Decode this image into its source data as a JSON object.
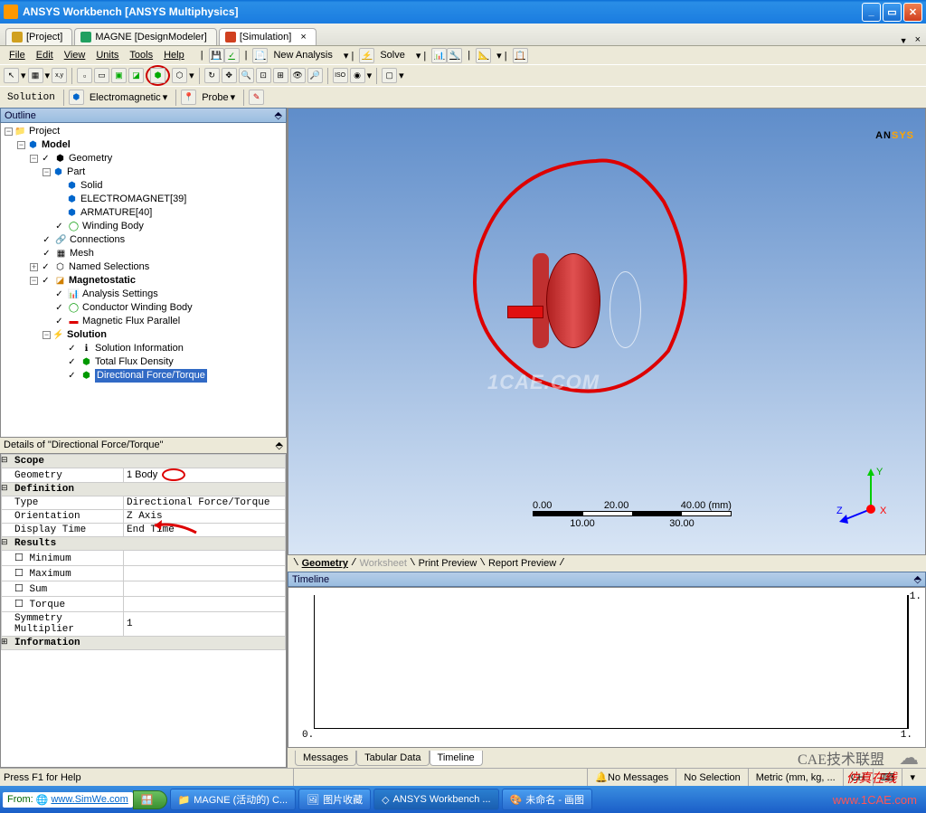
{
  "title": "ANSYS Workbench [ANSYS Multiphysics]",
  "doctabs": [
    {
      "label": "[Project]",
      "color": "#d0a020"
    },
    {
      "label": "MAGNE [DesignModeler]",
      "color": "#20a060"
    },
    {
      "label": "[Simulation]",
      "color": "#d04020",
      "active": true
    }
  ],
  "menu": {
    "items": [
      "File",
      "Edit",
      "View",
      "Units",
      "Tools",
      "Help"
    ],
    "after": [
      "New Analysis",
      "Solve"
    ]
  },
  "toolbar3": {
    "solution": "Solution",
    "electro": "Electromagnetic",
    "probe": "Probe"
  },
  "outline_hdr": "Outline",
  "tree": {
    "project": "Project",
    "model": "Model",
    "geometry": "Geometry",
    "part": "Part",
    "solid": "Solid",
    "electromagnet": "ELECTROMAGNET[39]",
    "armature": "ARMATURE[40]",
    "windingbody": "Winding Body",
    "connections": "Connections",
    "mesh": "Mesh",
    "namedsel": "Named Selections",
    "magneto": "Magnetostatic",
    "analysis": "Analysis Settings",
    "conductor": "Conductor Winding Body",
    "magflux": "Magnetic Flux Parallel",
    "solution": "Solution",
    "solinfo": "Solution Information",
    "totalflux": "Total Flux Density",
    "dirforce": "Directional Force/Torque"
  },
  "details_hdr": "Details of \"Directional Force/Torque\"",
  "details": {
    "scope": "Scope",
    "geometry_k": "Geometry",
    "geometry_v": "1 Body",
    "definition": "Definition",
    "type_k": "Type",
    "type_v": "Directional Force/Torque",
    "orient_k": "Orientation",
    "orient_v": "Z Axis",
    "disptime_k": "Display Time",
    "disptime_v": "End Time",
    "results": "Results",
    "min": "Minimum",
    "max": "Maximum",
    "sum": "Sum",
    "torque": "Torque",
    "symm_k": "Symmetry Multiplier",
    "symm_v": "1",
    "info": "Information"
  },
  "scale": {
    "t0": "0.00",
    "t1": "20.00",
    "t2": "40.00 (mm)",
    "b0": "10.00",
    "b1": "30.00"
  },
  "viewtabs": {
    "geo": "Geometry",
    "ws": "Worksheet",
    "pp": "Print Preview",
    "rp": "Report Preview"
  },
  "timeline_hdr": "Timeline",
  "chart": {
    "x0": "0.",
    "x1": "1.",
    "y1": "1."
  },
  "bottabs": {
    "msg": "Messages",
    "td": "Tabular Data",
    "tl": "Timeline"
  },
  "status": {
    "help": "Press F1 for Help",
    "nomsg": "No Messages",
    "nosel": "No Selection",
    "units": "Metric (mm, kg, ...",
    "ch": "CH"
  },
  "taskbar": {
    "from": "From:",
    "simwe": "www.SimWe.com",
    "t1": "MAGNE (活动的) C...",
    "t2": "图片收藏",
    "t3": "ANSYS Workbench ...",
    "t4": "未命名 - 画图"
  },
  "watermark": {
    "cae": "1CAE.COM",
    "caelm": "CAE技术联盟",
    "fz": "仿真在线",
    "url": "www.1CAE.com"
  },
  "chart_data": {
    "type": "line",
    "title": "Timeline",
    "x": [
      0,
      1
    ],
    "xlim": [
      0,
      1
    ],
    "ylim": [
      0,
      1
    ],
    "series": [],
    "xlabel": "",
    "ylabel": ""
  }
}
